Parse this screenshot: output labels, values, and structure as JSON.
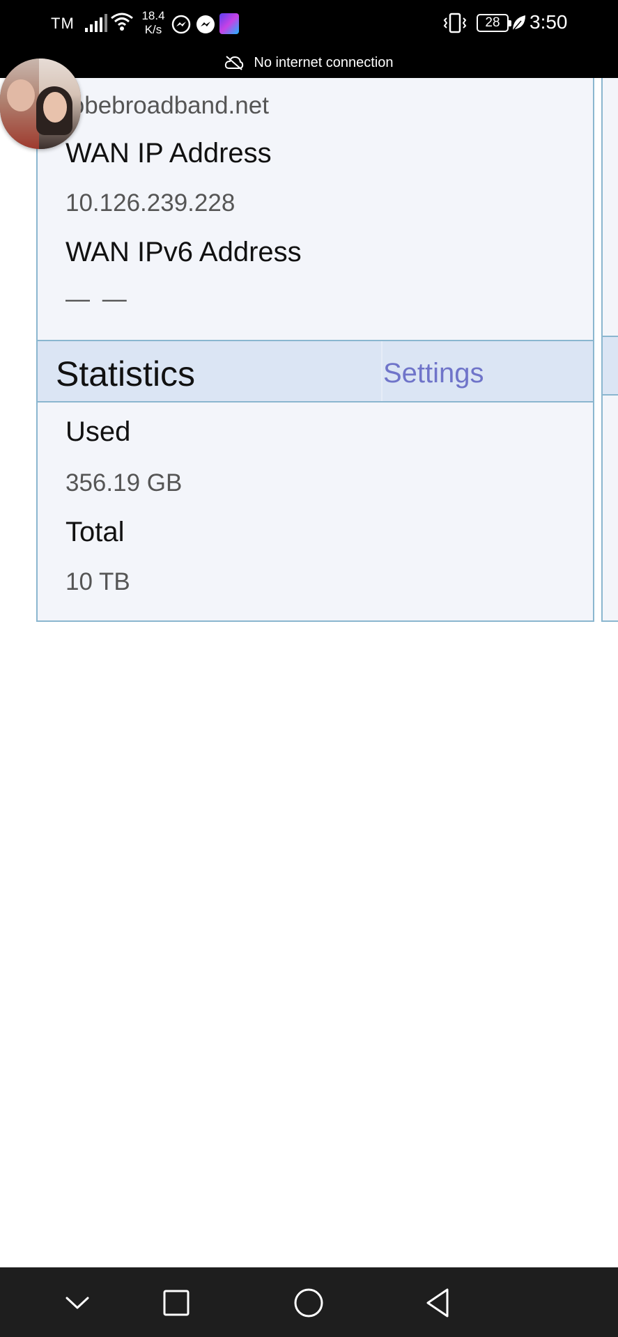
{
  "status_bar": {
    "carrier": "TM",
    "network_speed_value": "18.4",
    "network_speed_unit": "K/s",
    "battery_level": "28",
    "time": "3:50",
    "connection_notice": "No internet connection",
    "icons": [
      "signal-icon",
      "wifi-icon",
      "messenger-icon",
      "messenger-icon",
      "app-icon",
      "vibrate-icon",
      "battery-icon",
      "battery-saver-leaf-icon"
    ]
  },
  "connection_info": {
    "isp_value": "lobebroadband.net",
    "wan_ip_label": "WAN IP Address",
    "wan_ip_value": "10.126.239.228",
    "wan_ipv6_label": "WAN IPv6 Address",
    "wan_ipv6_value": "— —"
  },
  "statistics": {
    "title": "Statistics",
    "settings_link": "Settings",
    "used_label": "Used",
    "used_value": "356.19 GB",
    "total_label": "Total",
    "total_value": "10 TB"
  },
  "nav_bar": {
    "buttons": [
      "hide-keyboard-icon",
      "recents-icon",
      "home-icon",
      "back-icon"
    ]
  },
  "colors": {
    "card_background": "#f3f5fa",
    "header_background": "#dbe5f4",
    "border": "#8ab6cf",
    "link": "#6f74c9"
  }
}
